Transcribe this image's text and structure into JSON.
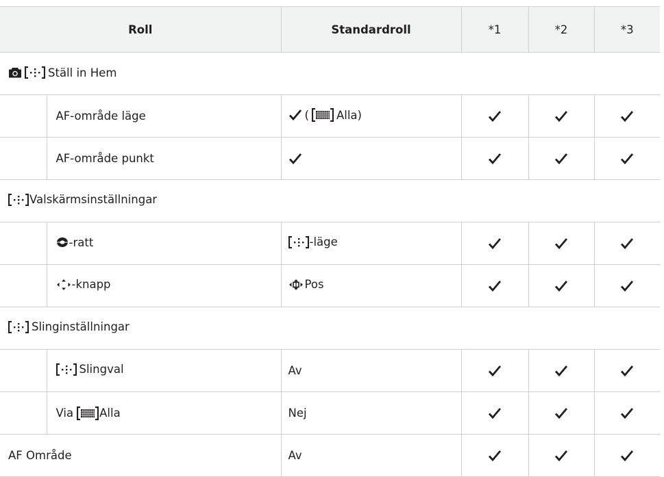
{
  "header": {
    "roll": "Roll",
    "standardroll": "Standardroll",
    "s1": "*1",
    "s2": "*2",
    "s3": "*3"
  },
  "sections": {
    "home": {
      "label": "Ställ in Hem"
    },
    "valskarm": {
      "label": "Valskärmsinställningar"
    },
    "sling": {
      "label": "Slinginställningar"
    }
  },
  "rows": {
    "af_mode": {
      "name": "AF-område läge",
      "std_prefix": "(",
      "std_suffix": "Alla)"
    },
    "af_point": {
      "name": "AF-område punkt"
    },
    "ratt": {
      "name": "-ratt",
      "std": "-läge"
    },
    "knapp": {
      "name": "-knapp",
      "std": "Pos"
    },
    "slingval": {
      "name": "Slingval",
      "std": "Av"
    },
    "via": {
      "name_prefix": "Via",
      "name_suffix": "Alla",
      "std": "Nej"
    },
    "af_omrade": {
      "name": "AF Område",
      "std": "Av"
    }
  },
  "icons": {
    "camera": "camera-icon",
    "af_target": "af-target-icon",
    "all_target": "all-target-grid-icon",
    "dial": "dial-icon",
    "arrow_pad": "arrow-pad-icon",
    "check": "check-icon"
  },
  "colors": {
    "header_bg": "#f1f2f2",
    "border": "#d0d0d0",
    "text": "#231f20"
  }
}
